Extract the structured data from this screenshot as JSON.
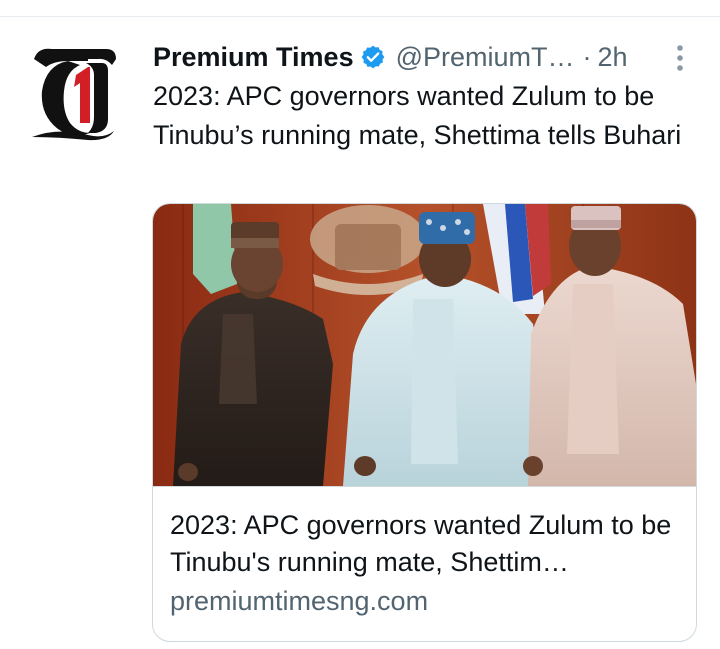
{
  "tweet": {
    "display_name": "Premium Times",
    "handle": "@PremiumT…",
    "separator": "·",
    "time": "2h",
    "text": "2023: APC governors wanted Zulum to be Tinubu’s running mate, Shettima tells Buhari",
    "avatar_icon": "premium-times-logo",
    "verified_icon": "verified-badge-icon",
    "more_icon": "more-options-icon"
  },
  "card": {
    "title": "2023: APC governors wanted Zulum to be Tinubu's running mate, Shettim…",
    "domain": "premiumtimesng.com",
    "image_icon": "article-photo"
  },
  "colors": {
    "verified": "#1d9bf0",
    "secondary_text": "#536471",
    "primary_text": "#0f1419",
    "logo_red": "#d21f26"
  }
}
